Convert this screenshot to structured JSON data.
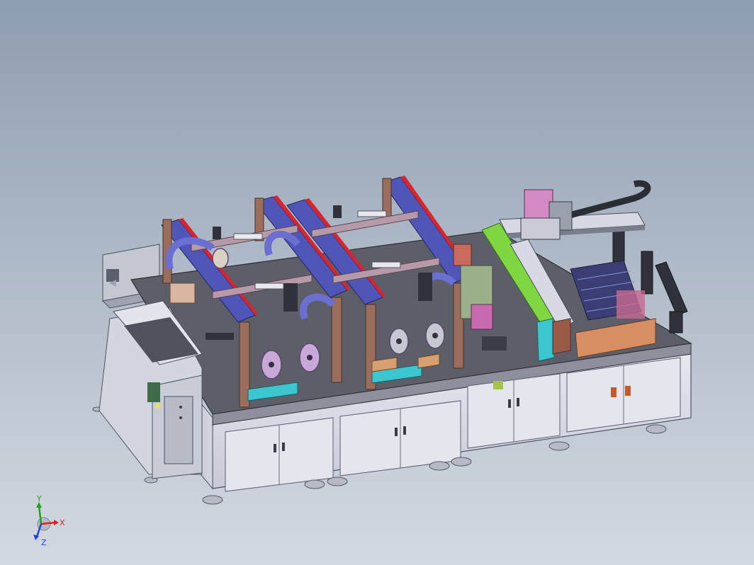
{
  "viewport": {
    "background_top": "#8e9db0",
    "background_bottom": "#d3d9e1"
  },
  "model": {
    "description_colors": {
      "cabinet": "#dcdde6",
      "cabinet_edge": "#5a5e73",
      "table_top": "#5b5e66",
      "frame_blue": "#4f56b8",
      "frame_red": "#d8242d",
      "frame_pink": "#b79aa9",
      "frame_brown": "#9a6d5c",
      "rail_green": "#7fd640",
      "cyan_part": "#3cc6d0",
      "orange_panel": "#d78e63",
      "chain_dark": "#2a2d33",
      "reel": "#c8a8d6"
    }
  },
  "triad": {
    "x_label": "X",
    "y_label": "Y",
    "z_label": "Z",
    "x_color": "#e02020",
    "y_color": "#20a020",
    "z_color": "#2040e0"
  }
}
